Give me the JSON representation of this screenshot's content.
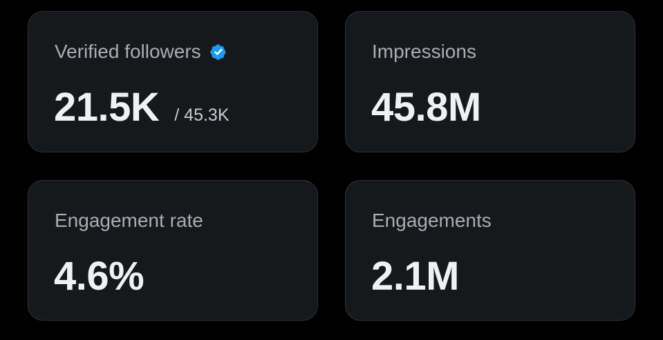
{
  "colors": {
    "background": "#000000",
    "card": "#16181c",
    "card_border": "#2f3336",
    "label": "#a9aeb3",
    "value": "#eff1f3",
    "verified_badge": "#1d9bf0"
  },
  "cards": [
    {
      "label": "Verified followers",
      "value": "21.5K",
      "sub_value": "/ 45.3K",
      "icon": "verified-badge-icon"
    },
    {
      "label": "Impressions",
      "value": "45.8M"
    },
    {
      "label": "Engagement rate",
      "value": "4.6%"
    },
    {
      "label": "Engagements",
      "value": "2.1M"
    }
  ]
}
